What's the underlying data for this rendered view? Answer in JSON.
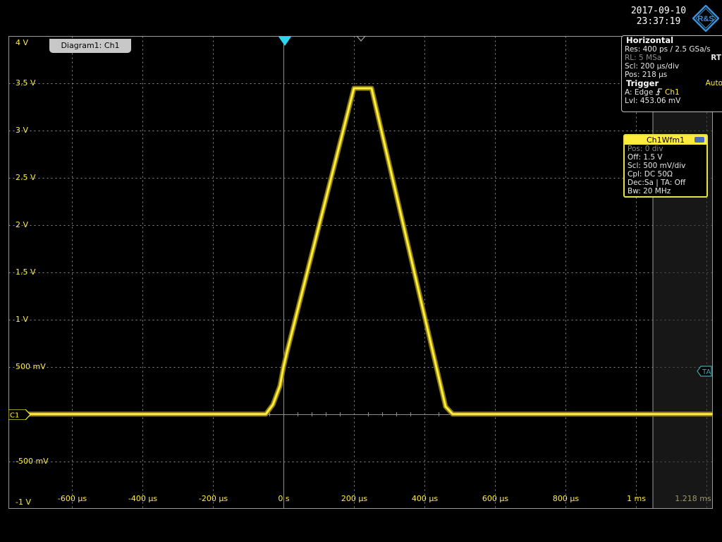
{
  "datetime": {
    "date": "2017-09-10",
    "time": "23:37:19"
  },
  "logo": {
    "text": "R&S"
  },
  "diagram_tab": {
    "label": "Diagram1: Ch1"
  },
  "channel_marker": {
    "label": "C1"
  },
  "ta_marker": {
    "label": "TA"
  },
  "y_labels": [
    "4 V",
    "3.5 V",
    "3 V",
    "2.5 V",
    "2 V",
    "1.5 V",
    "1 V",
    "500 mV",
    "",
    "-500 mV",
    "-1 V"
  ],
  "x_labels": [
    "-600 µs",
    "-400 µs",
    "-200 µs",
    "0 s",
    "200 µs",
    "400 µs",
    "600 µs",
    "800 µs",
    "1 ms",
    "1.218 ms"
  ],
  "horizontal": {
    "title": "Horizontal",
    "res": "Res: 400 ps / 2.5 GSa/s",
    "rl": "RL:  5 MSa",
    "rt": "RT",
    "scl": "Scl:  200 µs/div",
    "pos": "Pos: 218 µs"
  },
  "trigger": {
    "title": "Trigger",
    "mode": "Auto",
    "source_prefix": "A:   Edge",
    "source_channel": "Ch1",
    "level": "Lvl:  453.06 mV"
  },
  "wfm": {
    "title": "Ch1Wfm1",
    "pos": "Pos: 0 div",
    "off": "Off:  1.5 V",
    "scl": "Scl:  500 mV/div",
    "cpl": "Cpl:  DC 50Ω",
    "dec": "Dec:Sa | TA: Off",
    "bw": "Bw:  20 MHz"
  },
  "colors": {
    "trace": "#ffec3d",
    "grid": "#8c8c8c",
    "trigger_marker": "#2cd6f0",
    "panel_border": "#bdbdbd"
  },
  "chart_data": {
    "type": "line",
    "xlabel": "",
    "ylabel": "",
    "xlim": [
      -0.00078,
      0.001218
    ],
    "ylim": [
      -1.0,
      4.0
    ],
    "grid": true,
    "series": [
      {
        "x": [
          -0.00078,
          -5e-05,
          -3e-05,
          -1e-05,
          0.0,
          1e-05,
          0.0002,
          0.00025,
          0.00046,
          0.00048,
          0.001218
        ],
        "y": [
          0.0,
          0.0,
          0.1,
          0.3,
          0.5,
          0.66,
          3.45,
          3.45,
          0.08,
          0.0,
          0.0
        ]
      }
    ]
  }
}
